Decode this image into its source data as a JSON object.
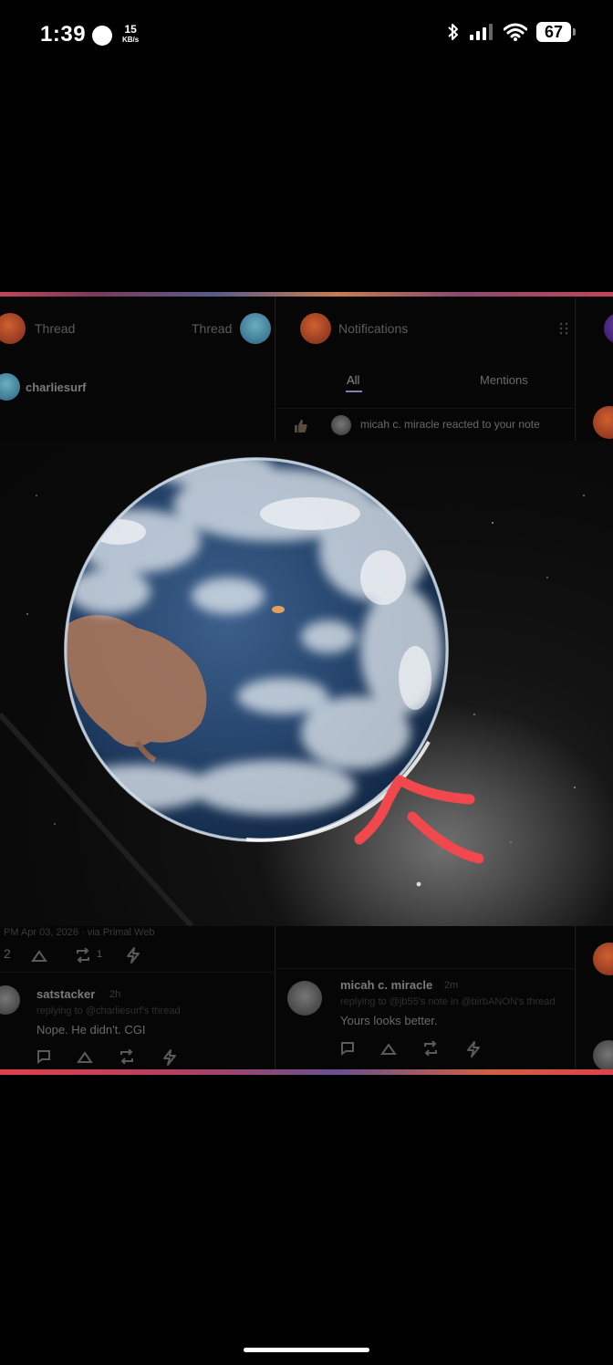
{
  "status_bar": {
    "time": "1:39",
    "net_speed_value": "15",
    "net_speed_unit": "KB/s",
    "battery": "67",
    "icons": [
      "bluetooth-icon",
      "signal-icon",
      "wifi-icon",
      "battery-icon"
    ]
  },
  "screenshot": {
    "left_column": {
      "header_left": "Thread",
      "header_right": "Thread",
      "author": "charliesurf",
      "timestamp_line": "PM Apr 03, 2026 · via Primal Web",
      "stats": {
        "replies": "2",
        "reposts": "1"
      },
      "reply": {
        "author": "satstacker",
        "age": "2h",
        "context": "replying to @charliesurf's thread",
        "text": "Nope. He didn't. CGI"
      }
    },
    "middle_column": {
      "header": "Notifications",
      "tabs": [
        "All",
        "Mentions"
      ],
      "active_tab": "All",
      "notification_text": "micah c. miracle reacted to your note",
      "reply": {
        "author": "micah c. miracle",
        "age": "2m",
        "context": "replying to @jb55's note in @birbANON's thread",
        "text": "Yours looks better."
      }
    },
    "photo": {
      "subject": "earth-image",
      "annotation": "red-arrow-annotation",
      "annotation_color": "#f0484c"
    }
  },
  "colors": {
    "background": "#000000",
    "annotation": "#f0484c",
    "tab_accent": "#8a7ab0"
  }
}
